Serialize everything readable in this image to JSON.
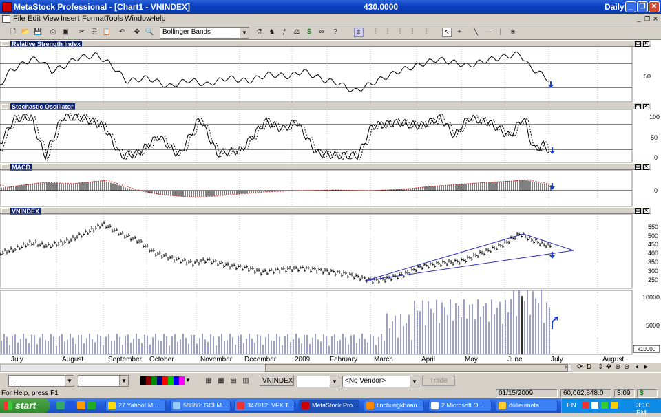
{
  "title": {
    "app": "MetaStock Professional - [Chart1 - VNINDEX]",
    "price": "430.0000",
    "period": "Daily"
  },
  "menu": [
    "File",
    "Edit",
    "View",
    "Insert",
    "Format",
    "Tools",
    "Window",
    "Help"
  ],
  "toolbar": {
    "indicator_select": "Bollinger Bands"
  },
  "panels": {
    "rsi": "Relative Strength Index",
    "stoch": "Stochastic Oscillator",
    "macd": "MACD",
    "price": "VNINDEX"
  },
  "axis": {
    "rsi": [
      "50"
    ],
    "stoch": [
      "100",
      "50",
      "0"
    ],
    "macd": [
      "0"
    ],
    "price": [
      "550",
      "500",
      "450",
      "400",
      "350",
      "300",
      "250"
    ],
    "volume": [
      "10000",
      "5000"
    ],
    "volume_scale": "x10000"
  },
  "months": [
    "July",
    "August",
    "September",
    "October",
    "November",
    "December",
    "2009",
    "February",
    "March",
    "April",
    "May",
    "June",
    "July",
    "August"
  ],
  "bottom": {
    "symbol": "VNINDEX",
    "vendor": "<No Vendor>",
    "trade": "Trade"
  },
  "status": {
    "help": "For Help, press F1",
    "date": "01/15/2009",
    "volume": "60,062,848.0",
    "time": "3:09",
    "money": "$"
  },
  "taskbar": {
    "start": "start",
    "tasks": [
      "27 Yahoo! M...",
      "58686: GCI M...",
      "347912: VFX T...",
      "MetaStock Pro...",
      "tinchungkhoan...",
      "2 Microsoft O...",
      "dulieumeta"
    ],
    "lang": "EN",
    "clock": "3:10 PM"
  },
  "colors": {
    "title_blue": "#0a3fc0",
    "marker_blue": "#1a3fd0",
    "trend": "#3030c0",
    "volume": "#8080c0",
    "macd_signal": "#e02020"
  }
}
